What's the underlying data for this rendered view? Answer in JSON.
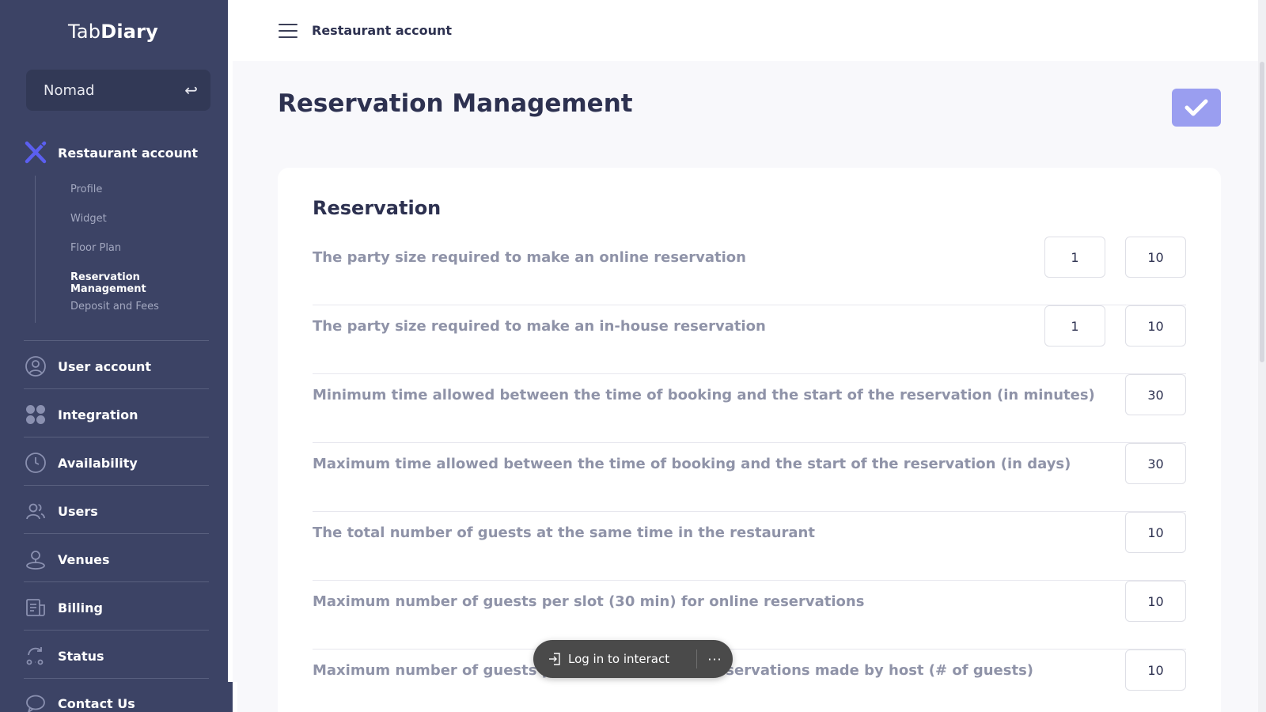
{
  "app": {
    "logo_prefix": "Tab",
    "logo_suffix": "Diary",
    "venue": "Nomad"
  },
  "header": {
    "breadcrumb": "Restaurant account"
  },
  "sidebar": {
    "main_item": "Restaurant account",
    "sub_items": [
      "Profile",
      "Widget",
      "Floor Plan",
      "Reservation Management",
      "Deposit and Fees"
    ],
    "active_sub": "Reservation Management",
    "items": [
      "User account",
      "Integration",
      "Availability",
      "Users",
      "Venues",
      "Billing",
      "Status",
      "Contact Us"
    ]
  },
  "page": {
    "title": "Reservation Management",
    "section_title": "Reservation",
    "rows": [
      {
        "label": "The party size required to make an online reservation",
        "min": "1",
        "max": "10"
      },
      {
        "label": "The party size required to make an in-house reservation",
        "min": "1",
        "max": "10"
      },
      {
        "label": "Minimum time allowed between the time of booking and the start of the reservation (in minutes)",
        "value": "30"
      },
      {
        "label": "Maximum time allowed between the time of booking and the start of the reservation (in days)",
        "value": "30"
      },
      {
        "label": "The total number of guests at the same time in the restaurant",
        "value": "10"
      },
      {
        "label": "Maximum number of guests per slot (30 min) for online reservations",
        "value": "10"
      },
      {
        "label": "Maximum number of guests per slot (30 min) for reservations made by host (# of guests)",
        "value": "10"
      }
    ]
  },
  "overlay": {
    "login_label": "Log in to interact",
    "more_label": "···"
  },
  "colors": {
    "sidebar_bg": "#3c4365",
    "accent": "#5b5ff0",
    "save_button": "#9a9ef0"
  }
}
